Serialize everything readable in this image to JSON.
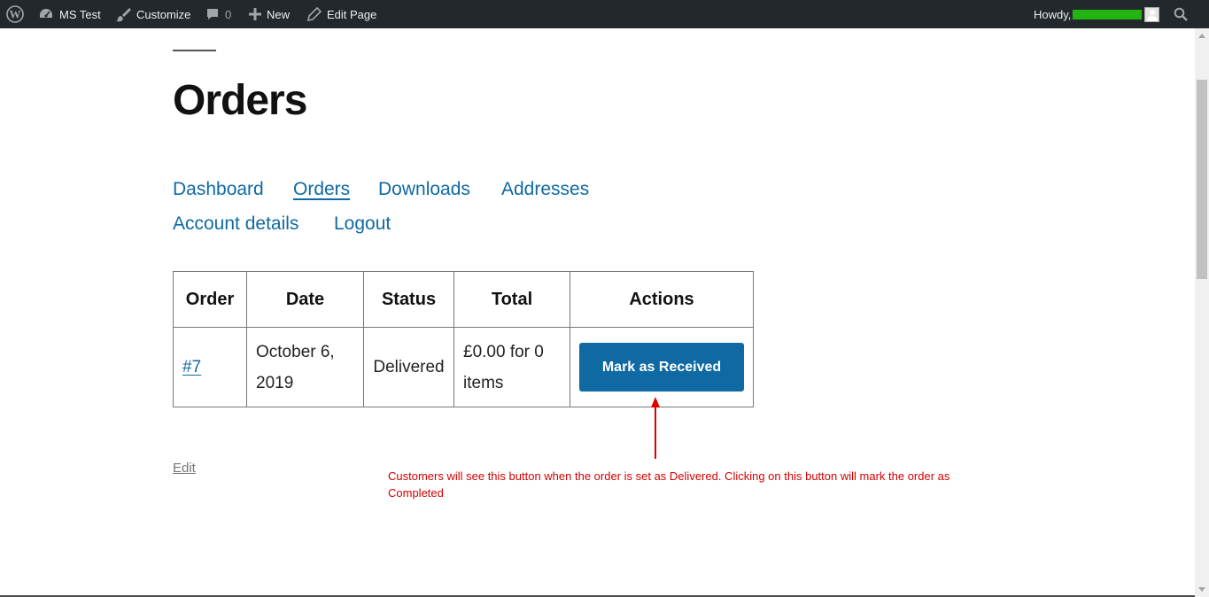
{
  "adminbar": {
    "site_name": "MS Test",
    "customize": "Customize",
    "comments_count": "0",
    "new": "New",
    "edit_page": "Edit Page",
    "howdy": "Howdy,"
  },
  "page": {
    "title": "Orders",
    "edit_link": "Edit"
  },
  "nav": {
    "dashboard": "Dashboard",
    "orders": "Orders",
    "downloads": "Downloads",
    "addresses": "Addresses",
    "account_details": "Account details",
    "logout": "Logout"
  },
  "table": {
    "headers": [
      "Order",
      "Date",
      "Status",
      "Total",
      "Actions"
    ],
    "rows": [
      {
        "order": "#7",
        "date": "October 6, 2019",
        "status": "Delivered",
        "total": "£0.00 for 0 items",
        "action": "Mark as Received"
      }
    ]
  },
  "annotation": "Customers will see this button when the order is set as Delivered. Clicking on this button will mark the order as Completed",
  "colors": {
    "adminbar_bg": "#23282d",
    "link": "#0f6aa3",
    "button": "#0f6aa3",
    "annotation": "#d40000",
    "username_redaction": "#22b512"
  },
  "icons": [
    "wordpress-logo-icon",
    "dashboard-icon",
    "brush-icon",
    "comment-icon",
    "plus-icon",
    "pencil-icon",
    "avatar",
    "search-icon"
  ]
}
